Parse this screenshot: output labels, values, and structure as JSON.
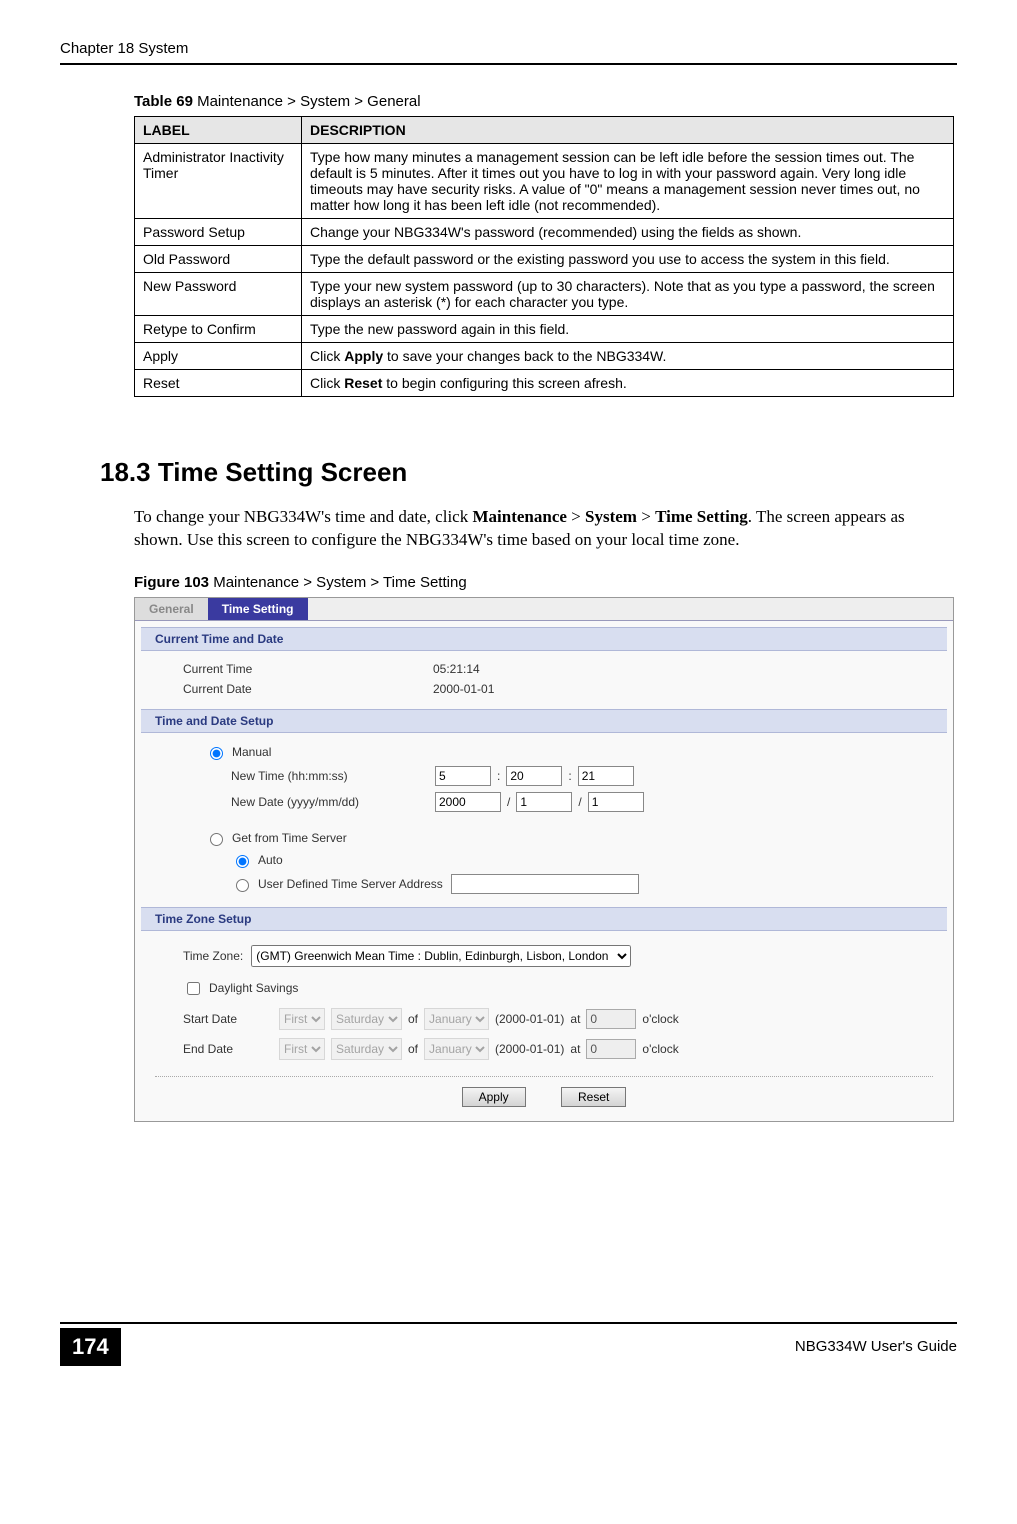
{
  "header": {
    "chapter": "Chapter 18 System"
  },
  "table": {
    "caption_bold": "Table 69",
    "caption_rest": "   Maintenance > System > General",
    "head_label": "LABEL",
    "head_desc": "DESCRIPTION",
    "rows": [
      {
        "label": "Administrator Inactivity Timer",
        "desc": "Type how many minutes a management session can be left idle before the session times out. The default is 5 minutes. After it times out you have to log in with your password again. Very long idle timeouts may have security risks. A value of \"0\" means a management session never times out, no matter how long it has been left idle (not recommended)."
      },
      {
        "label": "Password Setup",
        "desc": "Change your NBG334W's password (recommended) using the fields as shown."
      },
      {
        "label": "Old Password",
        "desc": "Type the default password or the existing password you use to access the system in this field."
      },
      {
        "label": "New Password",
        "desc": "Type your new system password (up to 30 characters). Note that as you type a password, the screen displays an asterisk (*) for each character you type."
      },
      {
        "label": "Retype to Confirm",
        "desc": "Type the new password again in this field."
      },
      {
        "label": "Apply",
        "desc_pre": "Click ",
        "desc_bold": "Apply",
        "desc_post": " to save your changes back to the NBG334W."
      },
      {
        "label": "Reset",
        "desc_pre": "Click ",
        "desc_bold": "Reset",
        "desc_post": " to begin configuring this screen afresh."
      }
    ]
  },
  "section": {
    "heading": "18.3  Time Setting Screen",
    "body_pre": "To change your NBG334W's time and date, click ",
    "body_b1": "Maintenance",
    "body_mid1": " > ",
    "body_b2": "System",
    "body_mid2": " > ",
    "body_b3": "Time Setting",
    "body_post": ". The screen appears as shown. Use this screen to configure the NBG334W's time based on your local time zone."
  },
  "figure": {
    "caption_bold": "Figure 103",
    "caption_rest": "   Maintenance > System > Time Setting"
  },
  "screenshot": {
    "tabs": {
      "general": "General",
      "time": "Time Setting"
    },
    "sec_current": "Current Time and Date",
    "current_time_lbl": "Current Time",
    "current_time_val": "05:21:14",
    "current_date_lbl": "Current Date",
    "current_date_val": "2000-01-01",
    "sec_setup": "Time and Date Setup",
    "manual_lbl": "Manual",
    "new_time_lbl": "New Time (hh:mm:ss)",
    "new_time_h": "5",
    "new_time_m": "20",
    "new_time_s": "21",
    "sep_colon": ":",
    "new_date_lbl": "New Date (yyyy/mm/dd)",
    "new_date_y": "2000",
    "new_date_m": "1",
    "new_date_d": "1",
    "sep_slash": "/",
    "get_server_lbl": "Get from Time Server",
    "auto_lbl": "Auto",
    "user_def_lbl": "User Defined Time Server Address",
    "sec_tz": "Time Zone Setup",
    "tz_lbl": "Time Zone:",
    "tz_val": "(GMT) Greenwich Mean Time : Dublin, Edinburgh, Lisbon, London",
    "dst_lbl": "Daylight Savings",
    "start_lbl": "Start Date",
    "end_lbl": "End Date",
    "ord": "First",
    "day": "Saturday",
    "of": "of",
    "month": "January",
    "dateparen": "(2000-01-01)",
    "at": "at",
    "hour_val": "0",
    "oclock": "o'clock",
    "apply": "Apply",
    "reset": "Reset"
  },
  "footer": {
    "page": "174",
    "guide": "NBG334W User's Guide"
  }
}
